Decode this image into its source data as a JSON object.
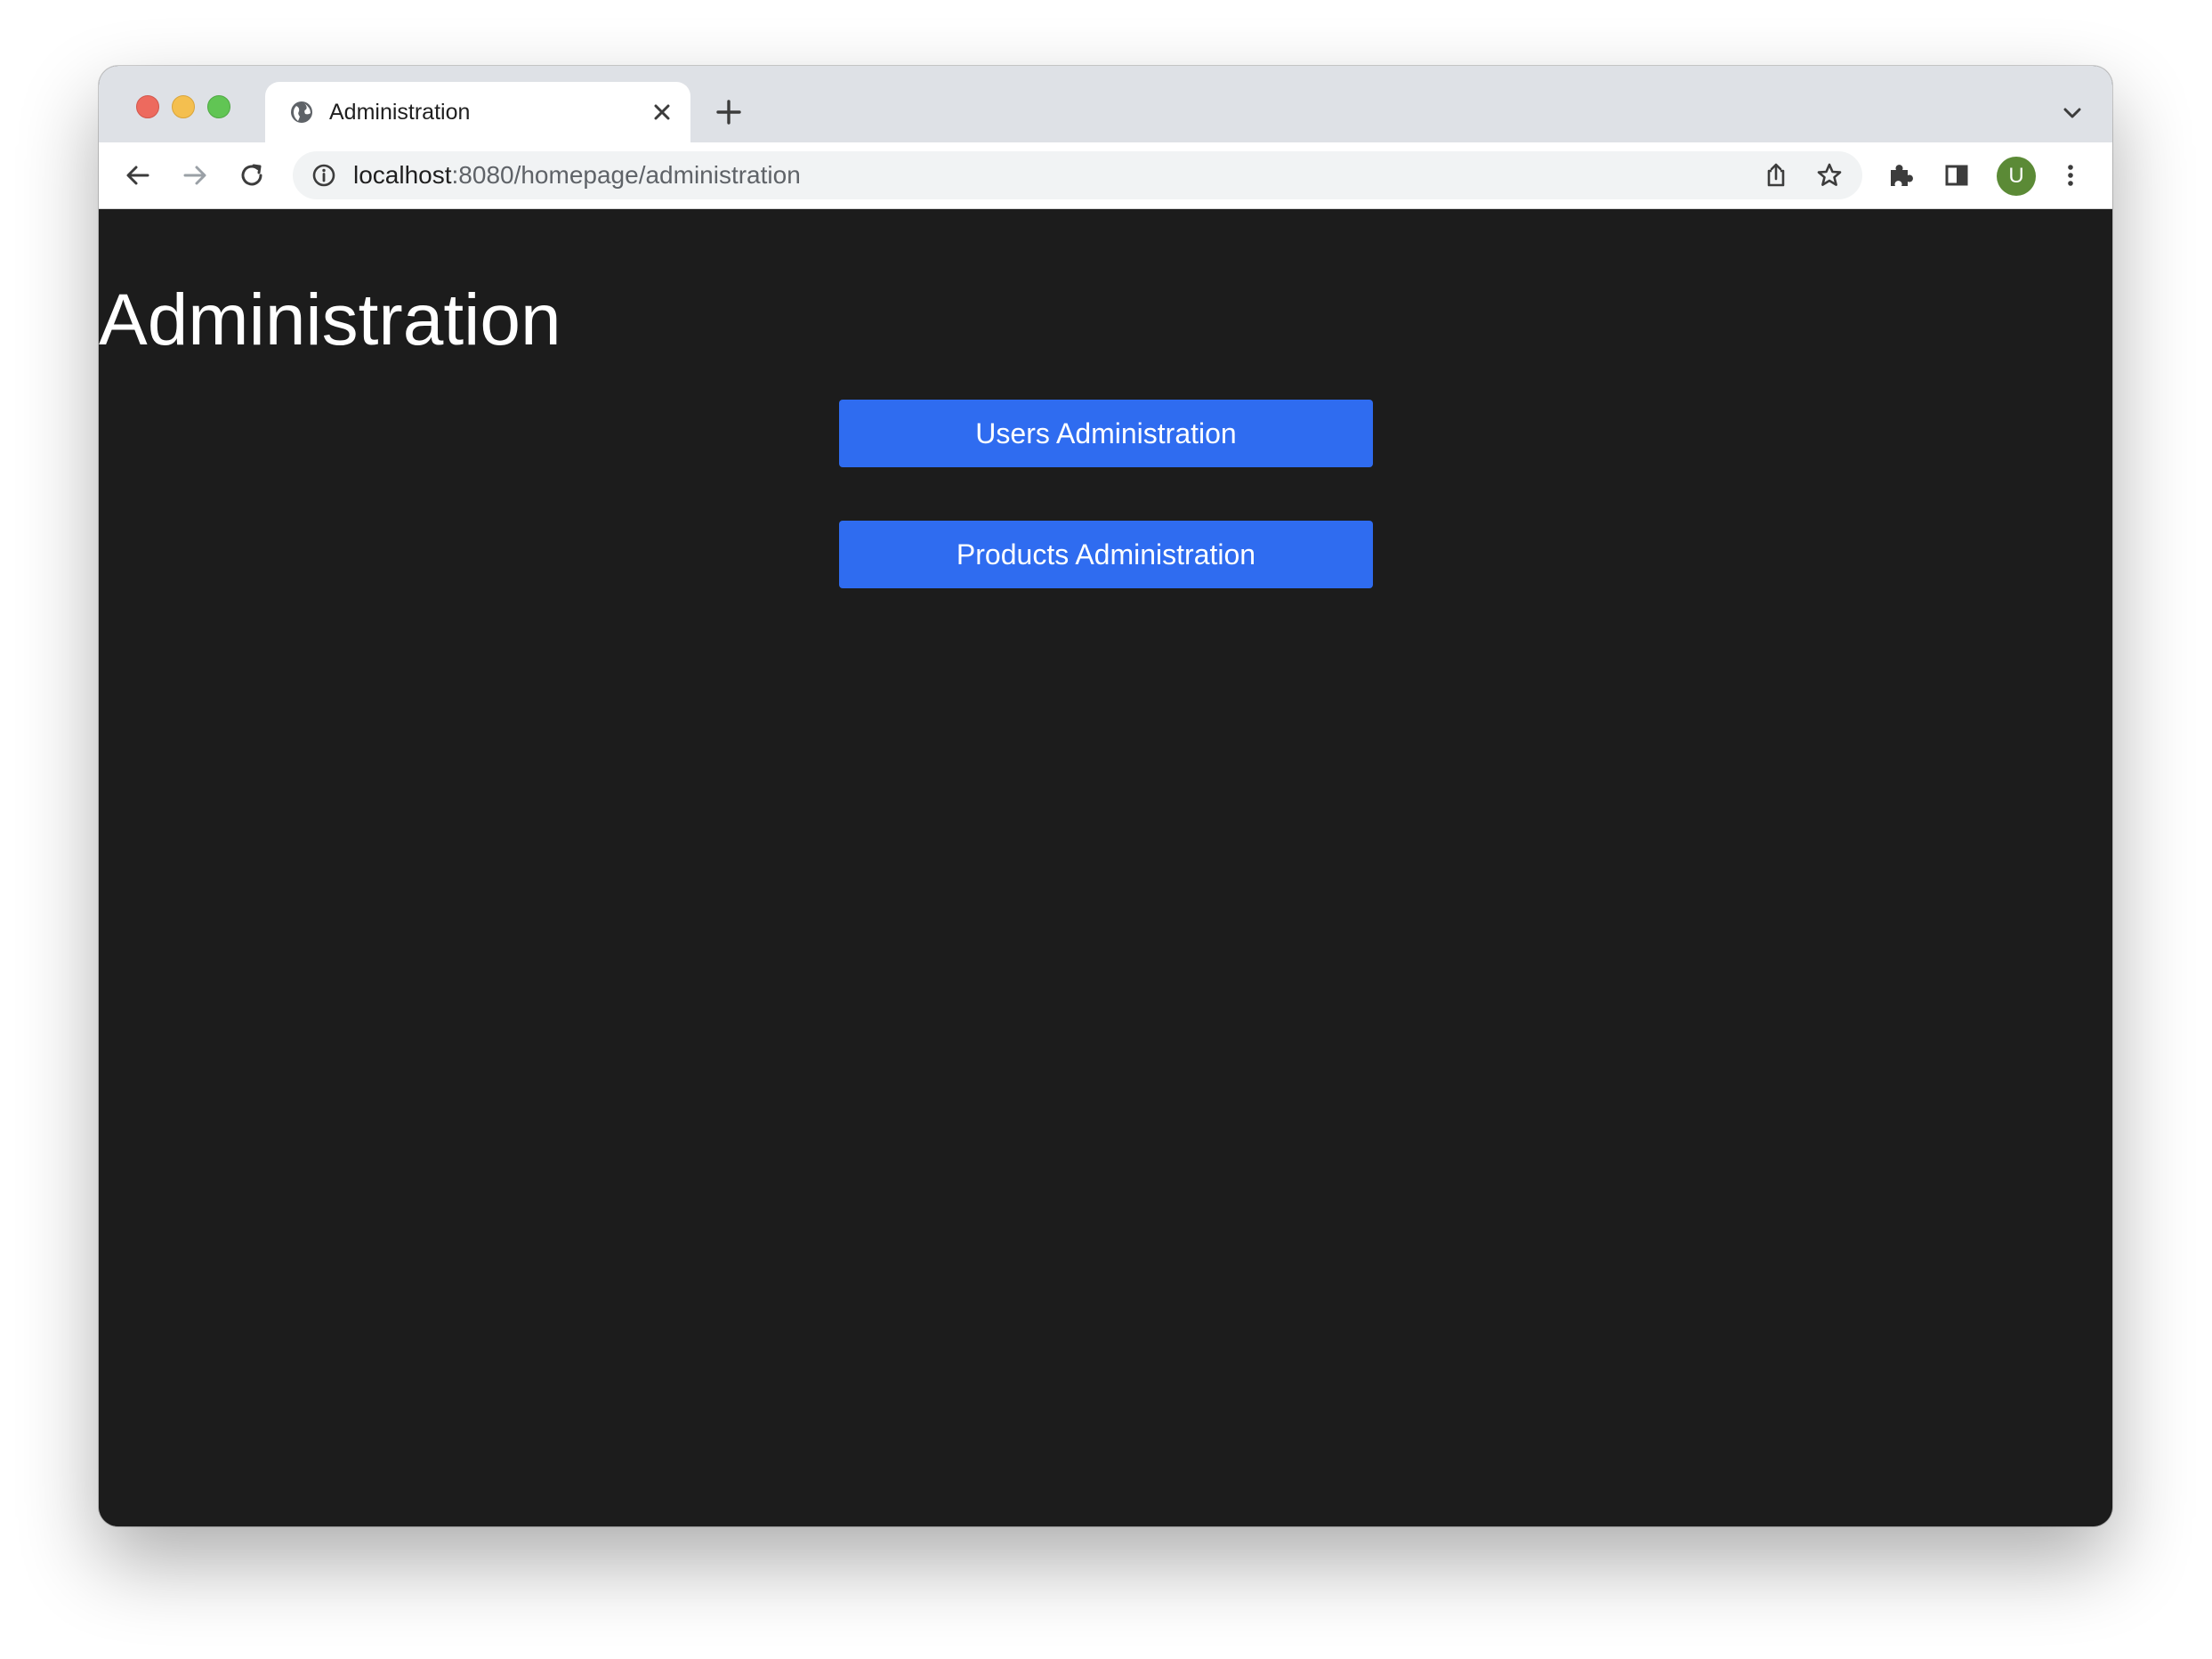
{
  "browser": {
    "tab": {
      "title": "Administration",
      "favicon": "globe-icon"
    },
    "address_bar": {
      "host": "localhost",
      "path": ":8080/homepage/administration"
    },
    "profile_initial": "U",
    "colors": {
      "tabstrip": "#dee1e6",
      "avatar": "#5b8a36"
    }
  },
  "page": {
    "title": "Administration",
    "buttons": {
      "users_label": "Users Administration",
      "products_label": "Products Administration"
    },
    "colors": {
      "background": "#1c1c1c",
      "button": "#2f6cf0",
      "text": "#ffffff"
    }
  }
}
